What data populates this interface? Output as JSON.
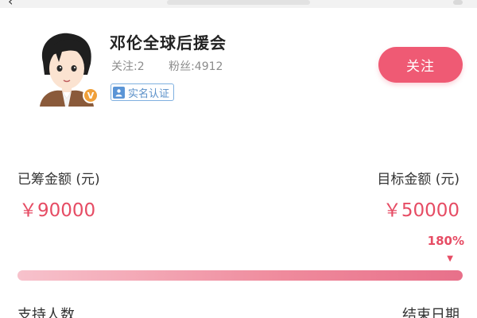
{
  "profile": {
    "name": "邓伦全球后援会",
    "follows": "关注:2",
    "fans": "粉丝:4912",
    "verified_label": "实名认证",
    "vip_badge": "V"
  },
  "actions": {
    "follow_label": "关注"
  },
  "funding": {
    "raised_label": "已筹金额 (元)",
    "raised_value": "￥90000",
    "target_label": "目标金额 (元)",
    "target_value": "￥50000",
    "percent": "180%",
    "progress_fraction": 1.0,
    "supporters_label": "支持人数",
    "end_date_label": "结束日期"
  },
  "colors": {
    "accent": "#ef5a74",
    "amount": "#e64c64",
    "verify": "#5b95d6"
  },
  "icons": {
    "back": "back-chevron-icon",
    "verify": "person-id-icon"
  }
}
